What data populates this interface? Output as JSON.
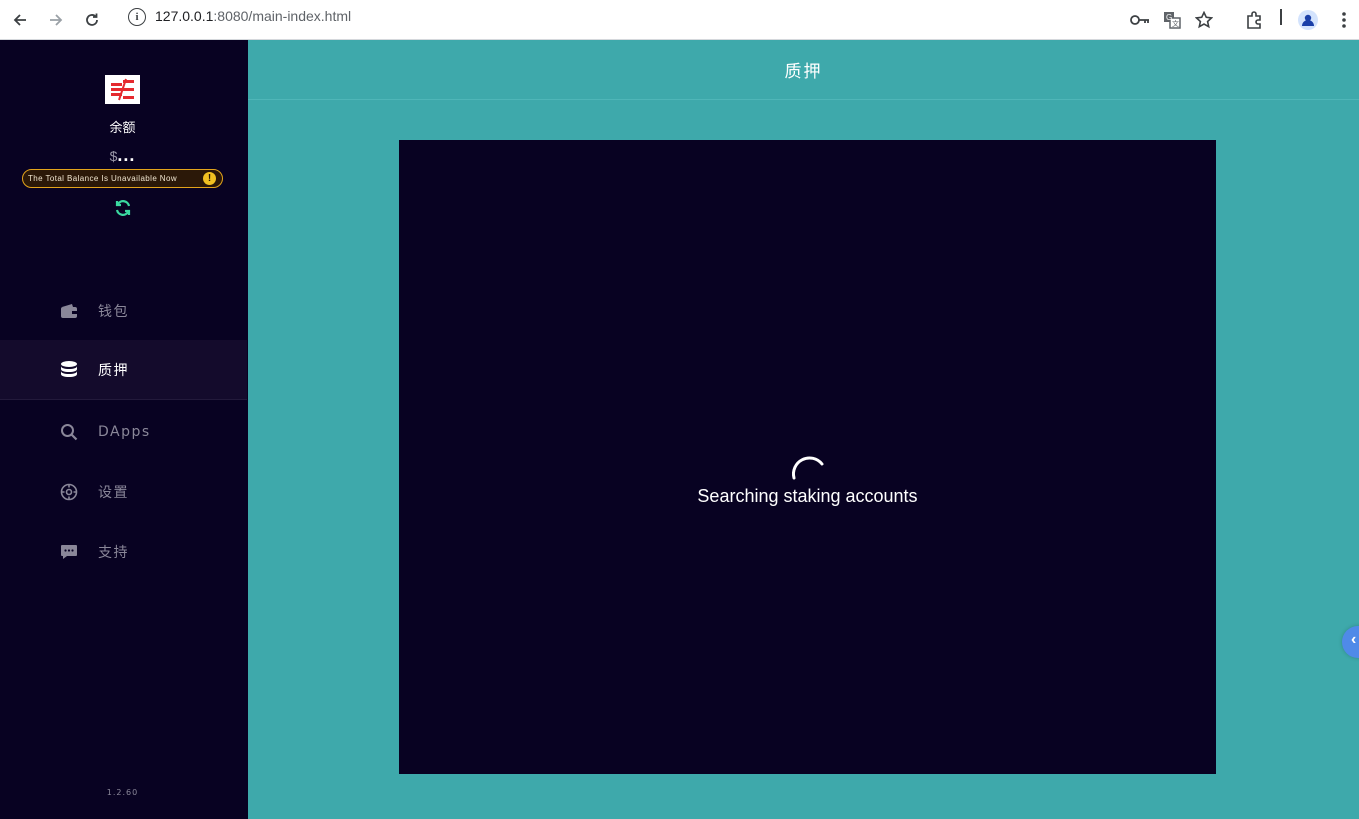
{
  "browser": {
    "url_host": "127.0.0.1",
    "url_path": ":8080/main-index.html",
    "icons": [
      "back-icon",
      "forward-icon",
      "reload-icon",
      "site-info-icon",
      "password-key-icon",
      "translate-icon",
      "bookmark-star-icon",
      "extensions-icon",
      "profile-icon",
      "menu-kebab-icon"
    ]
  },
  "sidebar": {
    "balance_label": "余额",
    "currency": "$",
    "balance_value": "...",
    "warning_text": "The Total Balance Is Unavailable Now",
    "warning_mark": "!",
    "items": [
      {
        "label": "钱包",
        "icon": "wallet-icon"
      },
      {
        "label": "质押",
        "icon": "database-stack-icon"
      },
      {
        "label": "DApps",
        "icon": "search-icon"
      },
      {
        "label": "设置",
        "icon": "settings-gear-icon"
      },
      {
        "label": "支持",
        "icon": "chat-bubble-icon"
      }
    ],
    "active_item": "质押",
    "version": "1.2.60"
  },
  "main": {
    "title": "质押",
    "loading_text": "Searching staking accounts"
  },
  "colors": {
    "sidebar_bg": "#080222",
    "main_bg": "#3ea9ab",
    "panel_bg": "#080222",
    "warning_accent": "#e3a41b",
    "refresh_accent": "#3ad9a0",
    "side_tab": "#4f8ae8"
  }
}
